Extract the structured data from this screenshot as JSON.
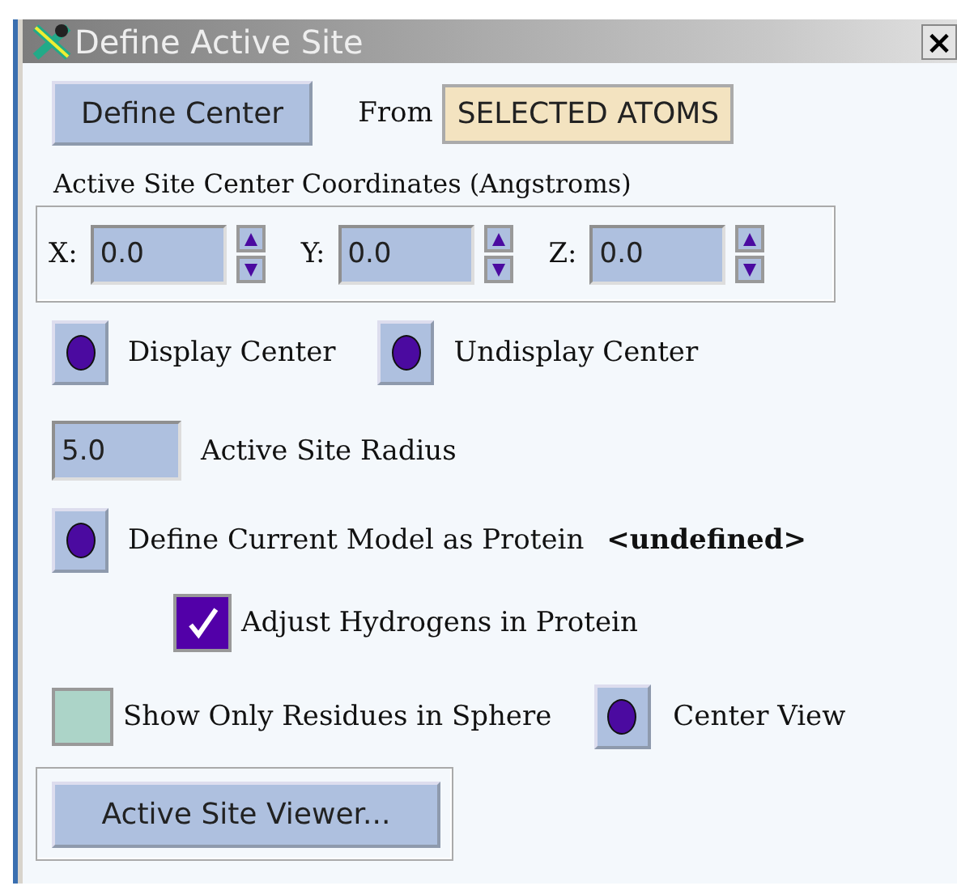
{
  "window": {
    "title": "Define Active Site",
    "close": "×"
  },
  "define_center": {
    "button": "Define Center",
    "from_label": "From",
    "from_value": "SELECTED ATOMS"
  },
  "coordinates": {
    "label": "Active Site Center Coordinates (Angstroms)",
    "axes": [
      {
        "label": "X:",
        "value": "0.0"
      },
      {
        "label": "Y:",
        "value": "0.0"
      },
      {
        "label": "Z:",
        "value": "0.0"
      }
    ]
  },
  "display_buttons": [
    {
      "label": "Display Center"
    },
    {
      "label": "Undisplay Center"
    }
  ],
  "radius": {
    "value": "5.0",
    "label": "Active Site Radius"
  },
  "protein": {
    "label": "Define Current Model as Protein",
    "status": "<undefined>"
  },
  "adjust_hydrogens": {
    "label": "Adjust Hydrogens in Protein",
    "checked": true
  },
  "show_only_residues": {
    "label": "Show Only Residues in Sphere",
    "checked": false
  },
  "center_view": {
    "label": "Center View"
  },
  "viewer_button": "Active Site Viewer..."
}
